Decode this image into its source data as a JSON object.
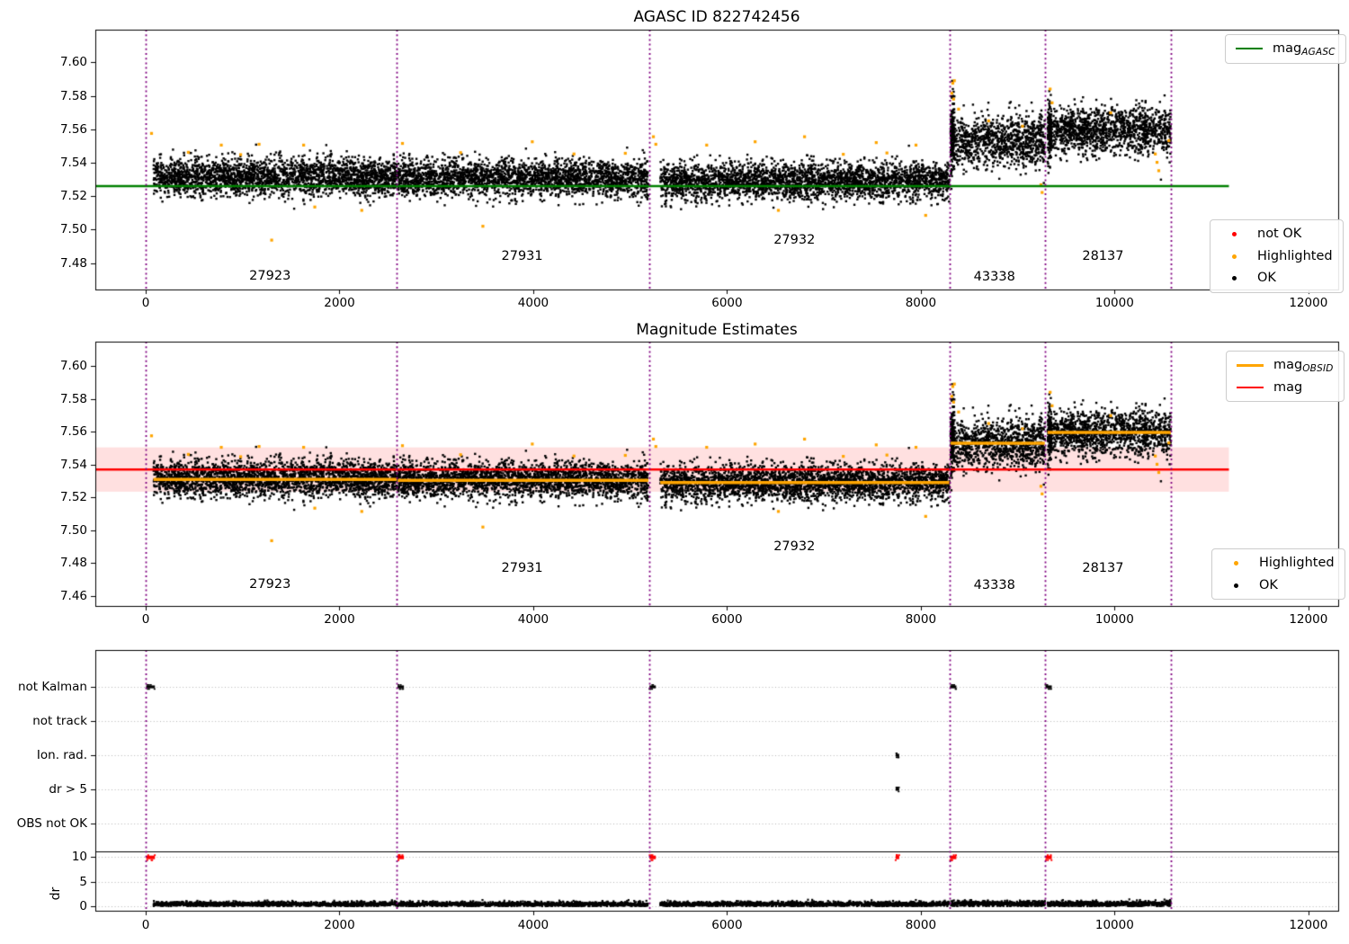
{
  "colors": {
    "ok": "#000000",
    "highlighted": "#ffa500",
    "not_ok": "#ff0000",
    "mag_agasc_line": "#008000",
    "mag_line": "#ff0000",
    "mag_obsid_line": "#ffa500",
    "obsid_boundary": "#800080",
    "mag_band": "rgba(255,0,0,0.12)",
    "grid": "#b5b5b5",
    "axis": "#000000"
  },
  "x_axis": {
    "lim": [
      -520,
      12308
    ],
    "ticks": [
      0,
      2000,
      4000,
      6000,
      8000,
      10000,
      12000
    ],
    "tick_labels": [
      "0",
      "2000",
      "4000",
      "6000",
      "8000",
      "10000",
      "12000"
    ]
  },
  "obsid_boundaries": [
    0,
    2590,
    5198,
    8300,
    9285,
    10585
  ],
  "chart_data": [
    {
      "id": "magnitudes",
      "type": "scatter",
      "title": "AGASC ID 822742456",
      "ylim": [
        7.4642,
        7.6195
      ],
      "ytick_values": [
        7.48,
        7.5,
        7.52,
        7.54,
        7.56,
        7.58,
        7.6
      ],
      "ytick_labels": [
        "7.48",
        "7.50",
        "7.52",
        "7.54",
        "7.56",
        "7.58",
        "7.60"
      ],
      "hline": {
        "label_prefix": "mag",
        "label_sub": "AGASC",
        "value": 7.526,
        "color_key": "mag_agasc_line",
        "x_extent": [
          -520,
          11180
        ]
      },
      "legend_markers": [
        {
          "label": "not OK",
          "color_key": "not_ok"
        },
        {
          "label": "Highlighted",
          "color_key": "highlighted"
        },
        {
          "label": "OK",
          "color_key": "ok"
        }
      ],
      "clusters": [
        {
          "obsid": "27923",
          "x_range": [
            80,
            2590
          ],
          "mean_mag": 7.5315,
          "std": 0.0055,
          "n": 2500
        },
        {
          "obsid": "27931",
          "x_range": [
            2602,
            5188
          ],
          "mean_mag": 7.5308,
          "std": 0.0055,
          "n": 2500
        },
        {
          "obsid": "27932",
          "x_range": [
            5310,
            8295
          ],
          "mean_mag": 7.529,
          "std": 0.0055,
          "n": 2850
        },
        {
          "obsid": "43338",
          "x_range": [
            8308,
            9280
          ],
          "mean_mag": 7.553,
          "std": 0.008,
          "n": 950
        },
        {
          "obsid": "43338s",
          "x_range": [
            8308,
            8348
          ],
          "mean_mag": 7.558,
          "std": 0.0115,
          "n": 130
        },
        {
          "obsid": "28137",
          "x_range": [
            9308,
            10582
          ],
          "mean_mag": 7.5592,
          "std": 0.007,
          "n": 1320
        },
        {
          "obsid": "28137s",
          "x_range": [
            9308,
            9348
          ],
          "mean_mag": 7.56,
          "std": 0.0105,
          "n": 110
        }
      ],
      "highlighted_points": [
        [
          60,
          7.5575
        ],
        [
          440,
          7.5462
        ],
        [
          780,
          7.5505
        ],
        [
          980,
          7.5448
        ],
        [
          1170,
          7.551
        ],
        [
          1300,
          7.4937
        ],
        [
          1630,
          7.5505
        ],
        [
          1745,
          7.5135
        ],
        [
          2230,
          7.5115
        ],
        [
          2650,
          7.5515
        ],
        [
          3250,
          7.546
        ],
        [
          3480,
          7.502
        ],
        [
          3990,
          7.5525
        ],
        [
          4420,
          7.5452
        ],
        [
          4950,
          7.5456
        ],
        [
          5240,
          7.5555
        ],
        [
          5265,
          7.551
        ],
        [
          5790,
          7.5505
        ],
        [
          6290,
          7.5525
        ],
        [
          6530,
          7.5115
        ],
        [
          6800,
          7.5555
        ],
        [
          7200,
          7.545
        ],
        [
          7540,
          7.552
        ],
        [
          7650,
          7.5458
        ],
        [
          7950,
          7.5505
        ],
        [
          8050,
          7.5085
        ],
        [
          8320,
          7.5815
        ],
        [
          8330,
          7.5875
        ],
        [
          8338,
          7.578
        ],
        [
          8346,
          7.589
        ],
        [
          8390,
          7.572
        ],
        [
          8700,
          7.565
        ],
        [
          9050,
          7.5618
        ],
        [
          9240,
          7.5268
        ],
        [
          9252,
          7.5222
        ],
        [
          9335,
          7.584
        ],
        [
          9355,
          7.5758
        ],
        [
          9960,
          7.5698
        ],
        [
          10420,
          7.5452
        ],
        [
          10438,
          7.5402
        ],
        [
          10456,
          7.5352
        ],
        [
          10560,
          7.5532
        ]
      ],
      "obsid_labels": [
        {
          "text": "27923",
          "x": 1283,
          "y": 7.472
        },
        {
          "text": "27931",
          "x": 3885,
          "y": 7.484
        },
        {
          "text": "27932",
          "x": 6695,
          "y": 7.494
        },
        {
          "text": "43338",
          "x": 8760,
          "y": 7.4715
        },
        {
          "text": "28137",
          "x": 9880,
          "y": 7.484
        }
      ]
    },
    {
      "id": "estimates",
      "type": "scatter",
      "title": "Magnitude Estimates",
      "ylim": [
        7.454,
        7.6148
      ],
      "ytick_values": [
        7.46,
        7.48,
        7.5,
        7.52,
        7.54,
        7.56,
        7.58,
        7.6
      ],
      "ytick_labels": [
        "7.46",
        "7.48",
        "7.50",
        "7.52",
        "7.54",
        "7.56",
        "7.58",
        "7.60"
      ],
      "hline": {
        "label_prefix": "mag",
        "label_sub": "",
        "value": 7.537,
        "color_key": "mag_line",
        "x_extent": [
          -520,
          11180
        ]
      },
      "band": {
        "range": [
          7.5235,
          7.5505
        ],
        "color_key": "mag_band",
        "x_extent": [
          -520,
          11180
        ]
      },
      "segments_legend": {
        "label_prefix": "mag",
        "label_sub": "OBSID",
        "color_key": "mag_obsid_line"
      },
      "segments": [
        {
          "obsid": "27923",
          "x_range": [
            80,
            2590
          ],
          "value": 7.531
        },
        {
          "obsid": "27931",
          "x_range": [
            2602,
            5188
          ],
          "value": 7.5305
        },
        {
          "obsid": "27932",
          "x_range": [
            5310,
            8295
          ],
          "value": 7.529
        },
        {
          "obsid": "43338",
          "x_range": [
            8308,
            9280
          ],
          "value": 7.553
        },
        {
          "obsid": "28137",
          "x_range": [
            9308,
            10582
          ],
          "value": 7.5595
        }
      ],
      "legend_markers": [
        {
          "label": "Highlighted",
          "color_key": "highlighted"
        },
        {
          "label": "OK",
          "color_key": "ok"
        }
      ],
      "obsid_labels": [
        {
          "text": "27923",
          "x": 1283,
          "y": 7.467
        },
        {
          "text": "27931",
          "x": 3885,
          "y": 7.477
        },
        {
          "text": "27932",
          "x": 6695,
          "y": 7.49
        },
        {
          "text": "43338",
          "x": 8760,
          "y": 7.4665
        },
        {
          "text": "28137",
          "x": 9880,
          "y": 7.477
        }
      ]
    },
    {
      "id": "flags",
      "type": "flags_scatter",
      "categories": [
        "not Kalman",
        "not track",
        "Ion. rad.",
        "dr > 5",
        "OBS not OK"
      ],
      "dr_axis_label": "dr",
      "dr_tick_values": [
        10,
        5,
        0
      ],
      "dr_tick_labels": [
        "10",
        "5",
        "0"
      ],
      "flag_events": [
        {
          "category": "not Kalman",
          "ranges": [
            [
              5,
              95
            ],
            [
              2600,
              2665
            ],
            [
              5200,
              5265
            ],
            [
              8302,
              8367
            ],
            [
              9287,
              9352
            ]
          ]
        },
        {
          "category": "not track",
          "ranges": []
        },
        {
          "category": "Ion. rad.",
          "ranges": [
            [
              7740,
              7750
            ]
          ]
        },
        {
          "category": "dr > 5",
          "ranges": [
            [
              7740,
              7750
            ]
          ]
        },
        {
          "category": "OBS not OK",
          "ranges": []
        }
      ],
      "dr_clipped_red_ranges": [
        [
          5,
          95
        ],
        [
          2600,
          2665
        ],
        [
          5200,
          5265
        ],
        [
          7740,
          7752
        ],
        [
          8302,
          8367
        ],
        [
          9287,
          9352
        ]
      ],
      "dr_clip_value": 10,
      "dr_noise_clusters": [
        {
          "x_range": [
            80,
            2590
          ],
          "mean": 0.42,
          "std": 0.25,
          "n": 1250
        },
        {
          "x_range": [
            2602,
            5188
          ],
          "mean": 0.42,
          "std": 0.25,
          "n": 1250
        },
        {
          "x_range": [
            5310,
            8295
          ],
          "mean": 0.42,
          "std": 0.25,
          "n": 1450
        },
        {
          "x_range": [
            8308,
            9280
          ],
          "mean": 0.52,
          "std": 0.3,
          "n": 500
        },
        {
          "x_range": [
            9308,
            10582
          ],
          "mean": 0.46,
          "std": 0.27,
          "n": 660
        }
      ]
    }
  ]
}
